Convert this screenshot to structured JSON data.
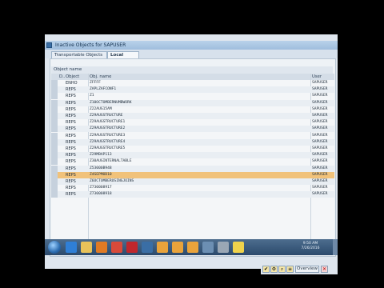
{
  "window": {
    "title": "Inactive Objects for SAPUSER"
  },
  "tabs": [
    {
      "label": "Transportable Objects"
    },
    {
      "label": "Local objects"
    }
  ],
  "group_header": "Object name",
  "columns": {
    "d": "D..",
    "object": "Object",
    "name": "Obj. name",
    "user": "User"
  },
  "rows": [
    {
      "object": "ENHO",
      "name": "ZFFFF",
      "user": "SAPUSER"
    },
    {
      "object": "REPS",
      "name": "ZAPLZAFCONF1",
      "user": "SAPUSER"
    },
    {
      "object": "REPS",
      "name": "Z1",
      "user": "SAPUSER"
    },
    {
      "object": "REPS",
      "name": "Z10OCTOMBERNUMBWORK",
      "user": "SAPUSER"
    },
    {
      "object": "REPS",
      "name": "Z22AUG15AM",
      "user": "SAPUSER"
    },
    {
      "object": "REPS",
      "name": "Z29AUGSTRUCTURE",
      "user": "SAPUSER"
    },
    {
      "object": "REPS",
      "name": "Z29AUGSTRUCTURE1",
      "user": "SAPUSER"
    },
    {
      "object": "REPS",
      "name": "Z29AUGSTRUCTURE2",
      "user": "SAPUSER"
    },
    {
      "object": "REPS",
      "name": "Z29AUGSTRUCTURE3",
      "user": "SAPUSER"
    },
    {
      "object": "REPS",
      "name": "Z29AUGSTRUCTURE4",
      "user": "SAPUSER"
    },
    {
      "object": "REPS",
      "name": "Z29AUGSTRUCTURE5",
      "user": "SAPUSER"
    },
    {
      "object": "REPS",
      "name": "Z29MBAP113",
      "user": "SAPUSER"
    },
    {
      "object": "REPS",
      "name": "Z30AUGINTERNALTABLE",
      "user": "SAPUSER"
    },
    {
      "object": "REPS",
      "name": "Z53000B948",
      "user": "SAPUSER"
    },
    {
      "object": "REPS",
      "name": "Z4SEPMOD10",
      "user": "SAPUSER",
      "selected": true
    },
    {
      "object": "REPS",
      "name": "Z6OCTOMBERUSINGJOINS",
      "user": "SAPUSER"
    },
    {
      "object": "REPS",
      "name": "Z730008917",
      "user": "SAPUSER"
    },
    {
      "object": "REPS",
      "name": "Z730008918",
      "user": "SAPUSER"
    }
  ],
  "actionbar": {
    "overview_label": "Overview",
    "close_label": "✕"
  },
  "taskbar": {
    "time": "9:50 AM",
    "date": "7/26/2016",
    "icons": [
      {
        "name": "ie-icon",
        "color": "#2f7fd6"
      },
      {
        "name": "folder-icon",
        "color": "#e8c25a"
      },
      {
        "name": "media-player-icon",
        "color": "#e07a24"
      },
      {
        "name": "chrome-icon",
        "color": "#d84a3a"
      },
      {
        "name": "pdf-icon",
        "color": "#c0272d"
      },
      {
        "name": "sap-logon-icon",
        "color": "#3a6ea5"
      },
      {
        "name": "sap-gui-icon",
        "color": "#e9a33b"
      },
      {
        "name": "sap-gui-icon-2",
        "color": "#e9a33b"
      },
      {
        "name": "sap-gui-icon-3",
        "color": "#e9a33b"
      },
      {
        "name": "explorer-icon",
        "color": "#6c8fb3"
      },
      {
        "name": "monitor-icon",
        "color": "#9aa7b5"
      },
      {
        "name": "notes-icon",
        "color": "#f0d34b"
      }
    ]
  }
}
